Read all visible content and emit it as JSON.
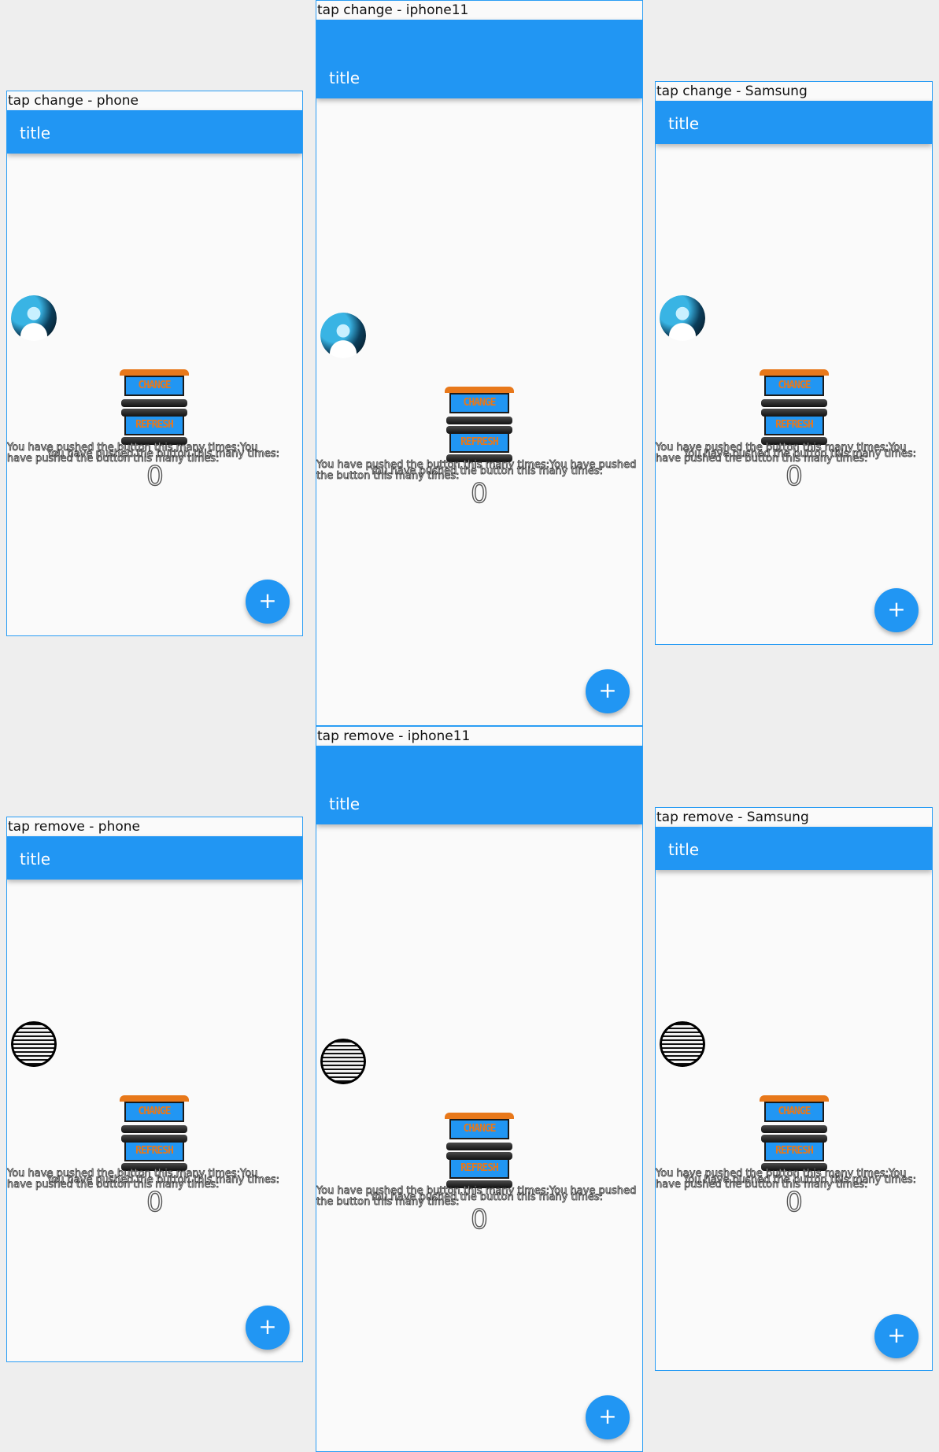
{
  "screens": [
    {
      "caption": "tap change - phone",
      "title": "title",
      "avatar": "photo",
      "sign_top_text": "CHANGE",
      "sign_bottom_text": "REFRESH",
      "message": "You have pushed the button this many times:You have pushed the button this many times:",
      "message_overlay": "You have pushed the button this many times:",
      "counter": "0",
      "fab_icon": "plus-icon"
    },
    {
      "caption": "tap change - iphone11",
      "title": "title",
      "avatar": "photo",
      "sign_top_text": "CHANGE",
      "sign_bottom_text": "REFRESH",
      "message": "You have pushed the button this many times:You have pushed the button this many times:",
      "message_overlay": "You have pushed the button this many times:",
      "counter": "0",
      "fab_icon": "plus-icon"
    },
    {
      "caption": "tap change - Samsung",
      "title": "title",
      "avatar": "photo",
      "sign_top_text": "CHANGE",
      "sign_bottom_text": "REFRESH",
      "message": "You have pushed the button this many times:You have pushed the button this many times:",
      "message_overlay": "You have pushed the button this many times:",
      "counter": "0",
      "fab_icon": "plus-icon"
    },
    {
      "caption": "tap remove - phone",
      "title": "title",
      "avatar": "striped",
      "sign_top_text": "CHANGE",
      "sign_bottom_text": "REFRESH",
      "message": "You have pushed the button this many times:You have pushed the button this many times:",
      "message_overlay": "You have pushed the button this many times:",
      "counter": "0",
      "fab_icon": "plus-icon"
    },
    {
      "caption": "tap remove - iphone11",
      "title": "title",
      "avatar": "striped",
      "sign_top_text": "CHANGE",
      "sign_bottom_text": "REFRESH",
      "message": "You have pushed the button this many times:You have pushed the button this many times:",
      "message_overlay": "You have pushed the button this many times:",
      "counter": "0",
      "fab_icon": "plus-icon"
    },
    {
      "caption": "tap remove - Samsung",
      "title": "title",
      "avatar": "striped",
      "sign_top_text": "CHANGE",
      "sign_bottom_text": "REFRESH",
      "message": "You have pushed the button this many times:You have pushed the button this many times:",
      "message_overlay": "You have pushed the button this many times:",
      "counter": "0",
      "fab_icon": "plus-icon"
    }
  ],
  "colors": {
    "appbar": "#2196f3",
    "accent": "#e8781a",
    "frame_border": "#2a9df4",
    "background": "#eeeeee"
  }
}
